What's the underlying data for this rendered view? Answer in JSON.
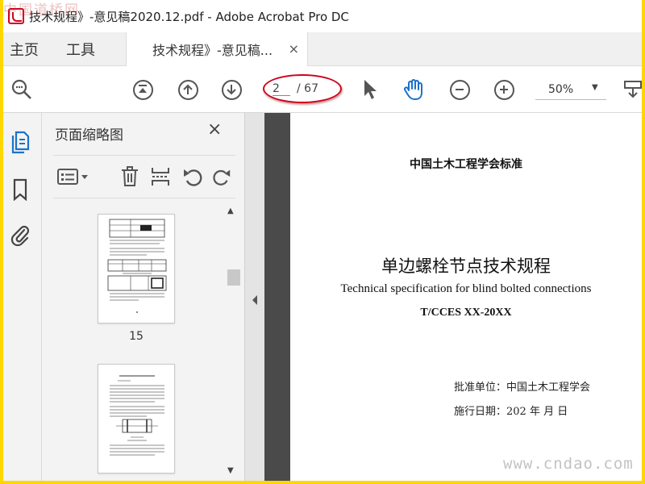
{
  "window": {
    "title": "技术规程》-意见稿2020.12.pdf - Adobe Acrobat Pro DC",
    "watermark_top": "中国道桥网",
    "watermark_bottom": "www.cndao.com"
  },
  "tabs": {
    "home": "主页",
    "tools": "工具",
    "document": "技术规程》-意见稿...",
    "close": "×"
  },
  "toolbar": {
    "page_current": "2",
    "page_total": "/ 67",
    "zoom": "50%",
    "zoom_caret": "▼",
    "highlight_color": "#d0021b",
    "icons": [
      "search-icon",
      "first-page-icon",
      "previous-page-icon",
      "next-page-icon",
      "select-pointer-icon",
      "hand-tool-icon",
      "zoom-out-icon",
      "zoom-in-icon",
      "more-tools-icon"
    ]
  },
  "rail": {
    "icons": [
      "page-thumbnails-icon",
      "bookmark-icon",
      "attachment-icon"
    ]
  },
  "thumbnails_panel": {
    "title": "页面缩略图",
    "close": "×",
    "tool_icons": [
      "options-icon",
      "delete-icon",
      "insert-icon",
      "rotate-left-icon",
      "rotate-right-icon"
    ],
    "pages": [
      {
        "label": "15"
      },
      {
        "label": ""
      }
    ],
    "scroll_up": "▲",
    "scroll_down": "▼"
  },
  "document_page": {
    "organization": "中国土木工程学会标准",
    "title": "单边螺栓节点技术规程",
    "english_title": "Technical specification for blind bolted connections",
    "code": "T/CCES XX-20XX",
    "approval": "批准单位：中国土木工程学会",
    "effective_date": "施行日期：202  年  月  日"
  }
}
